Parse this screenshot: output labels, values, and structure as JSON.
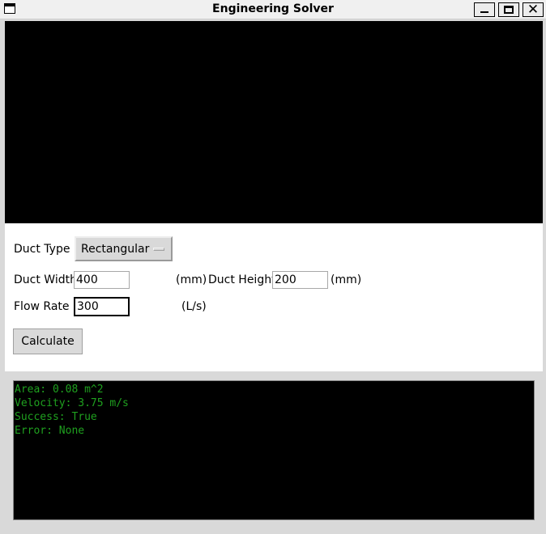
{
  "window": {
    "title": "Engineering Solver",
    "close_glyph": "✕"
  },
  "form": {
    "duct_type_label": "Duct Type",
    "duct_type_value": "Rectangular",
    "duct_width_label": "Duct Width",
    "duct_width_value": "400",
    "width_unit": "(mm)",
    "duct_height_label": "Duct Height",
    "duct_height_value": "200",
    "height_unit": "(mm)",
    "flow_rate_label": "Flow Rate",
    "flow_rate_value": "300",
    "flow_unit": "(L/s)",
    "calculate_label": "Calculate"
  },
  "output": {
    "lines": [
      "Area: 0.08 m^2",
      "Velocity: 3.75 m/s",
      "Success: True",
      "Error: None"
    ],
    "text_color": "#1fa01f"
  },
  "icons": {
    "app": "window-icon",
    "minimize": "minimize-icon",
    "maximize": "maximize-icon",
    "close": "close-icon"
  }
}
